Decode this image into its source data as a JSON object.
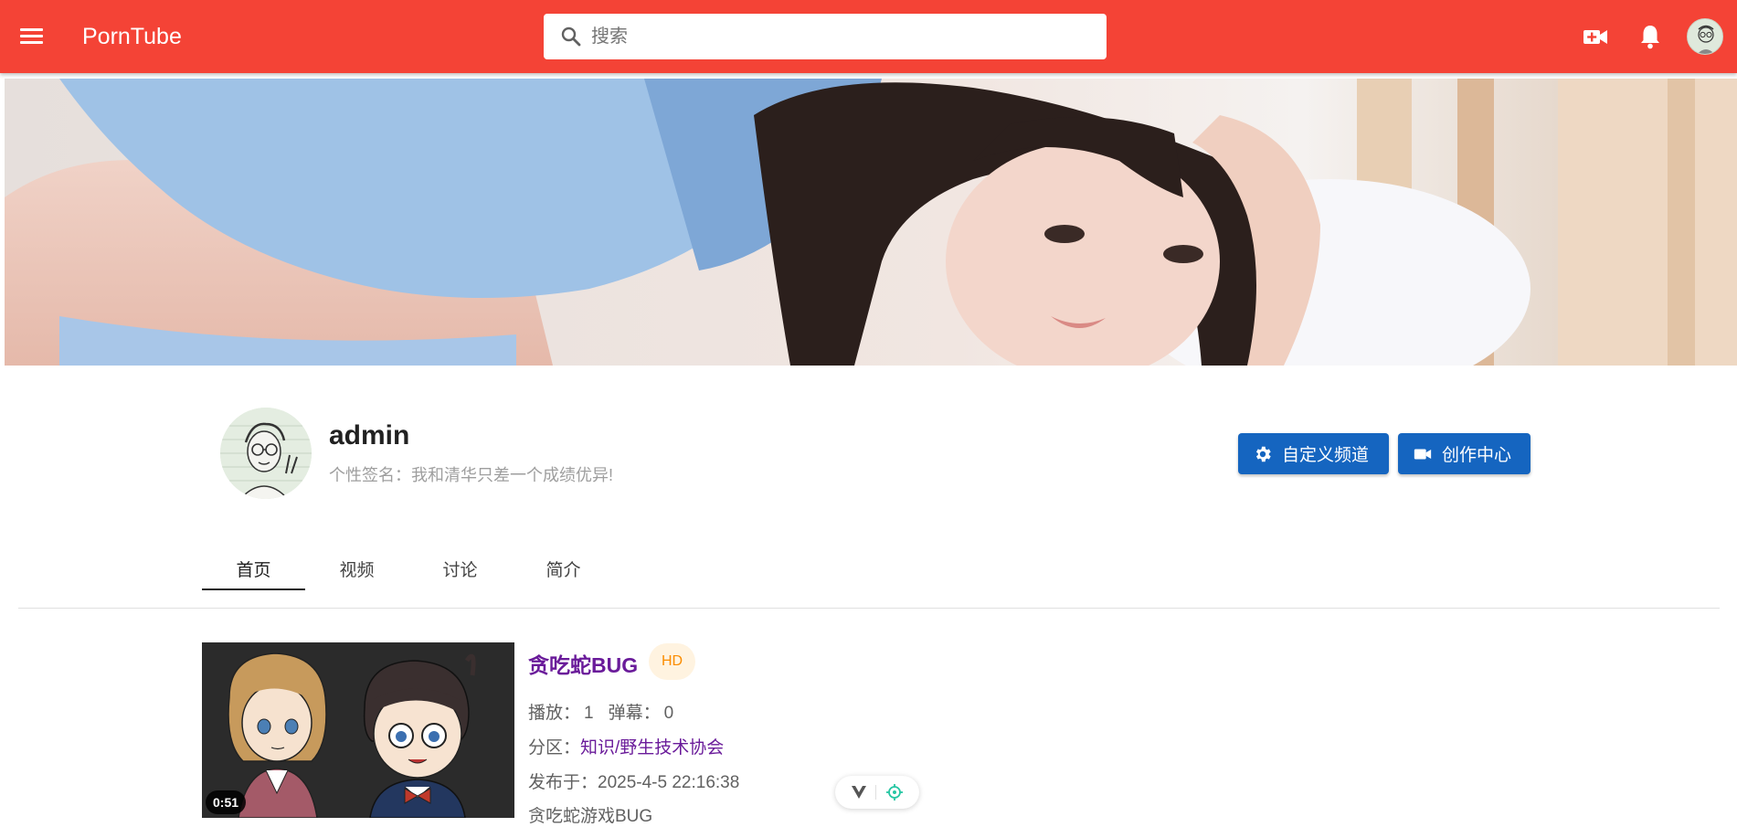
{
  "header": {
    "brand": "PornTube",
    "search_placeholder": "搜索",
    "icons": [
      "menu-icon",
      "search-icon",
      "video-camera-add-icon",
      "bell-icon",
      "user-avatar"
    ]
  },
  "colors": {
    "app_bar": "#f44336",
    "primary_button": "#1565c0",
    "title_link": "#6a1b9a",
    "hd_badge_text": "#fb8c00",
    "hd_badge_bg": "#fff3e0"
  },
  "profile": {
    "username": "admin",
    "signature": "个性签名：我和清华只差一个成绩优异!",
    "buttons": {
      "customize": "自定义频道",
      "studio": "创作中心"
    }
  },
  "tabs": [
    {
      "label": "首页",
      "active": true
    },
    {
      "label": "视频",
      "active": false
    },
    {
      "label": "讨论",
      "active": false
    },
    {
      "label": "简介",
      "active": false
    }
  ],
  "video": {
    "title": "贪吃蛇BUG",
    "badge": "HD",
    "duration": "0:51",
    "plays_label": "播放：",
    "plays": "1",
    "danmaku_label": "弹幕：",
    "danmaku": "0",
    "category_label": "分区：",
    "category": "知识/野生技术协会",
    "published_label": "发布于：",
    "published": "2025-4-5 22:16:38",
    "description": "贪吃蛇游戏BUG"
  }
}
